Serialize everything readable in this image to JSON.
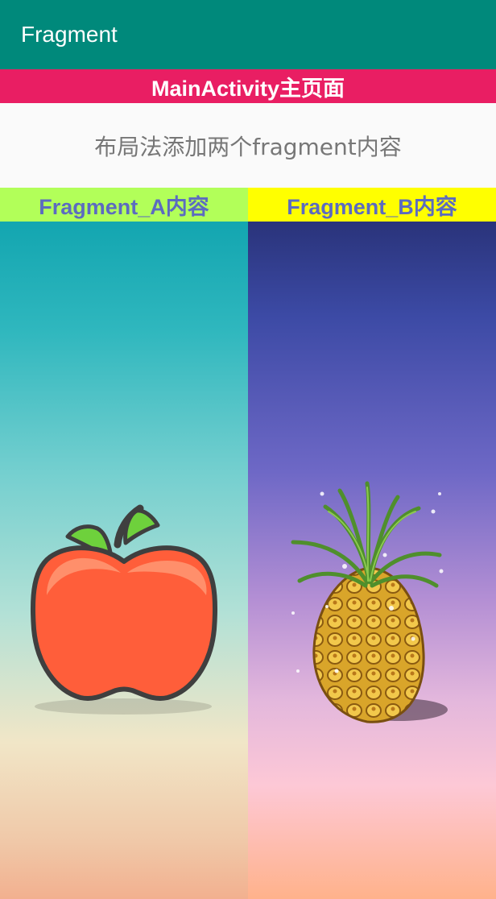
{
  "appbar": {
    "title": "Fragment"
  },
  "main": {
    "banner": "MainActivity主页面",
    "description": "布局法添加两个fragment内容"
  },
  "fragment_a": {
    "label": "Fragment_A内容",
    "image": "apple-icon"
  },
  "fragment_b": {
    "label": "Fragment_B内容",
    "image": "pineapple-icon"
  },
  "colors": {
    "appbar": "#00897b",
    "banner": "#e91e63",
    "fragment_a_label_bg": "#b2ff59",
    "fragment_b_label_bg": "#ffff00",
    "fragment_label_text": "#5c6bc0"
  }
}
